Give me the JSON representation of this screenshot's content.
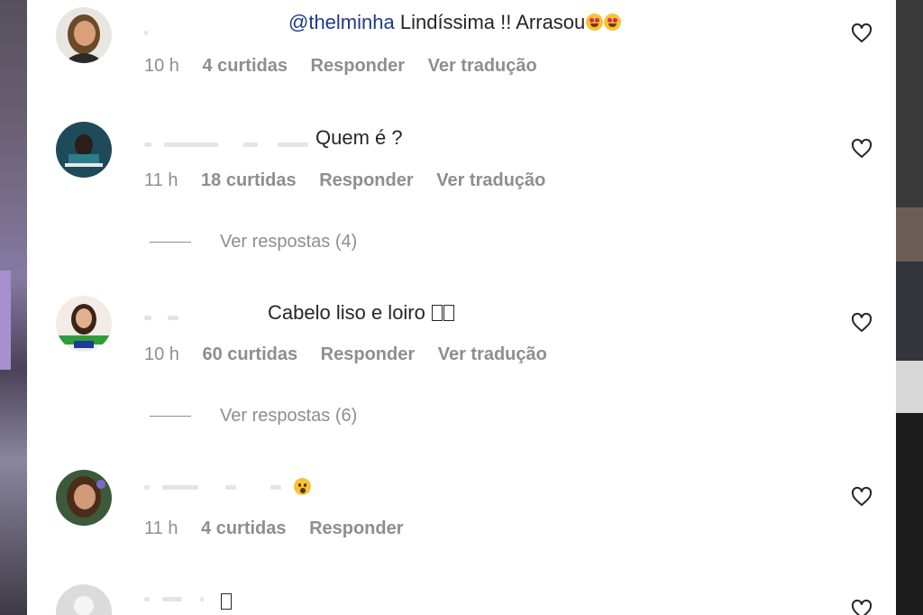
{
  "comments": [
    {
      "mention": "@thelminha",
      "text": " Lindíssima !! Arrasou",
      "emoji": [
        "heart-eyes-emoji",
        "heart-eyes-emoji"
      ],
      "time": "10 h",
      "likes": "4 curtidas",
      "reply": "Responder",
      "translate": "Ver tradução"
    },
    {
      "text": "Quem é ?",
      "time": "11 h",
      "likes": "18 curtidas",
      "reply": "Responder",
      "translate": "Ver tradução",
      "replies": "Ver respostas (4)"
    },
    {
      "text": "Cabelo liso e loiro",
      "time": "10 h",
      "likes": "60 curtidas",
      "reply": "Responder",
      "translate": "Ver tradução",
      "replies": "Ver respostas (6)"
    },
    {
      "emoji": [
        "astonished-emoji"
      ],
      "time": "11 h",
      "likes": "4 curtidas",
      "reply": "Responder"
    },
    {
      "text": ""
    }
  ],
  "colors": {
    "text": "#262626",
    "meta": "#8e8e8e",
    "mention": "#1e3a8a",
    "panel": "#ffffff"
  }
}
